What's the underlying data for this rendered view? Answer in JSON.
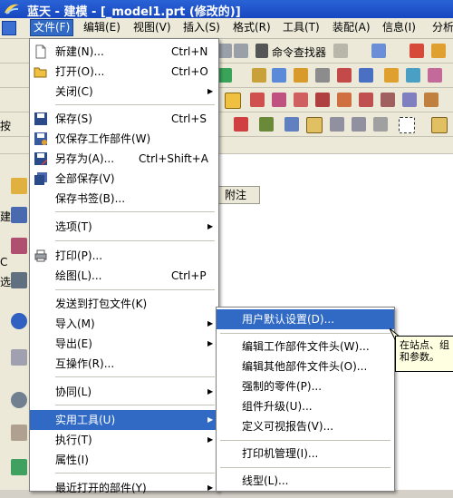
{
  "window": {
    "title": "蓝天 - 建模 - [_model1.prt (修改的)]"
  },
  "menubar": {
    "items": [
      "文件(F)",
      "编辑(E)",
      "视图(V)",
      "插入(S)",
      "格式(R)",
      "工具(T)",
      "装配(A)",
      "信息(I)",
      "分析"
    ]
  },
  "toolbar": {
    "command_finder": "命令查找器",
    "partial_label": "按"
  },
  "left_panel": {
    "partial_texts": [
      "建",
      "C",
      "选"
    ]
  },
  "table": {
    "column_header": "附注"
  },
  "file_menu": {
    "items": [
      {
        "label": "新建(N)...",
        "shortcut": "Ctrl+N",
        "icon": "new-file-icon"
      },
      {
        "label": "打开(O)...",
        "shortcut": "Ctrl+O",
        "icon": "open-folder-icon"
      },
      {
        "label": "关闭(C)",
        "submenu": true
      },
      {
        "label": "保存(S)",
        "shortcut": "Ctrl+S",
        "icon": "save-icon"
      },
      {
        "label": "仅保存工作部件(W)",
        "icon": "save-work-part-icon"
      },
      {
        "label": "另存为(A)...",
        "shortcut": "Ctrl+Shift+A",
        "icon": "save-as-icon"
      },
      {
        "label": "全部保存(V)",
        "icon": "save-all-icon"
      },
      {
        "label": "保存书签(B)..."
      },
      {
        "label": "选项(T)",
        "submenu": true
      },
      {
        "label": "打印(P)...",
        "icon": "printer-icon"
      },
      {
        "label": "绘图(L)...",
        "shortcut": "Ctrl+P"
      },
      {
        "label": "发送到打包文件(K)"
      },
      {
        "label": "导入(M)",
        "submenu": true
      },
      {
        "label": "导出(E)",
        "submenu": true
      },
      {
        "label": "互操作(R)..."
      },
      {
        "label": "协同(L)",
        "submenu": true
      },
      {
        "label": "实用工具(U)",
        "submenu": true
      },
      {
        "label": "执行(T)",
        "submenu": true
      },
      {
        "label": "属性(I)"
      },
      {
        "label": "最近打开的部件(Y)",
        "submenu": true
      }
    ]
  },
  "utilities_submenu": {
    "items": [
      {
        "label": "用户默认设置(D)..."
      },
      {
        "label": "编辑工作部件文件头(W)..."
      },
      {
        "label": "编辑其他部件文件头(O)..."
      },
      {
        "label": "强制的零件(P)..."
      },
      {
        "label": "组件升级(U)..."
      },
      {
        "label": "定义可视报告(V)..."
      },
      {
        "label": "打印机管理(I)..."
      },
      {
        "label": "线型(L)..."
      }
    ]
  },
  "tooltip": {
    "text": "在站点、组和参数。"
  },
  "colors": {
    "highlight": "#316ac5",
    "titlebar": "#1747c0",
    "tooltip_bg": "#ffffe1"
  }
}
